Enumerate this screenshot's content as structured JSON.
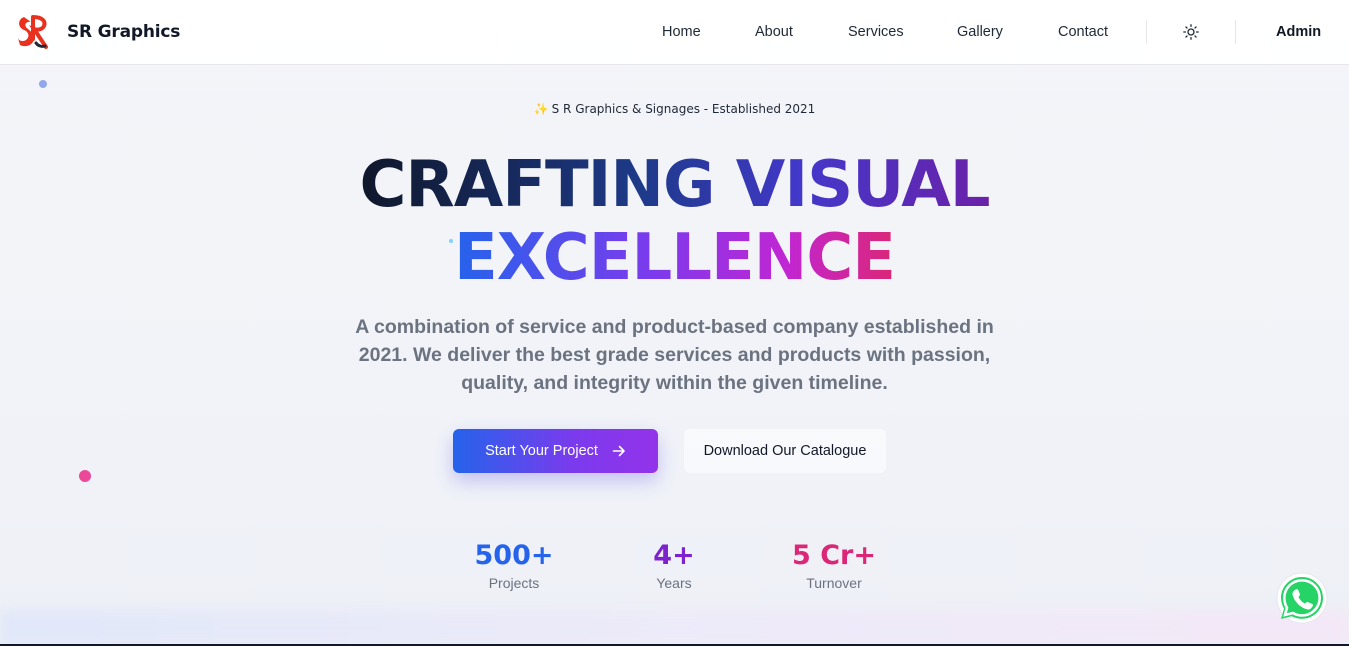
{
  "brand": {
    "name": "SR Graphics"
  },
  "nav": {
    "links": [
      "Home",
      "About",
      "Services",
      "Gallery",
      "Contact"
    ],
    "theme_toggle_icon": "sun-icon",
    "admin_label": "Admin"
  },
  "hero": {
    "eyebrow_icon": "sparkles-icon",
    "eyebrow": "S R Graphics & Signages - Established 2021",
    "headline_line1": "CRAFTING VISUAL",
    "headline_line2": "EXCELLENCE",
    "description": "A combination of service and product-based company established in 2021. We deliver the best grade services and products with passion, quality, and integrity within the given timeline.",
    "primary_cta": "Start Your Project",
    "primary_cta_icon": "arrow-right-icon",
    "secondary_cta": "Download Our Catalogue"
  },
  "stats": [
    {
      "value": "500+",
      "label": "Projects",
      "color": "#2563eb"
    },
    {
      "value": "4+",
      "label": "Years",
      "color": "#7e22ce"
    },
    {
      "value": "5 Cr+",
      "label": "Turnover",
      "color": "#db2777"
    }
  ],
  "colors": {
    "accent_blue": "#2563eb",
    "accent_purple": "#7c3aed",
    "accent_pink": "#db2777",
    "whatsapp_green": "#25d366"
  },
  "floating_widget": {
    "icon": "whatsapp-icon"
  }
}
